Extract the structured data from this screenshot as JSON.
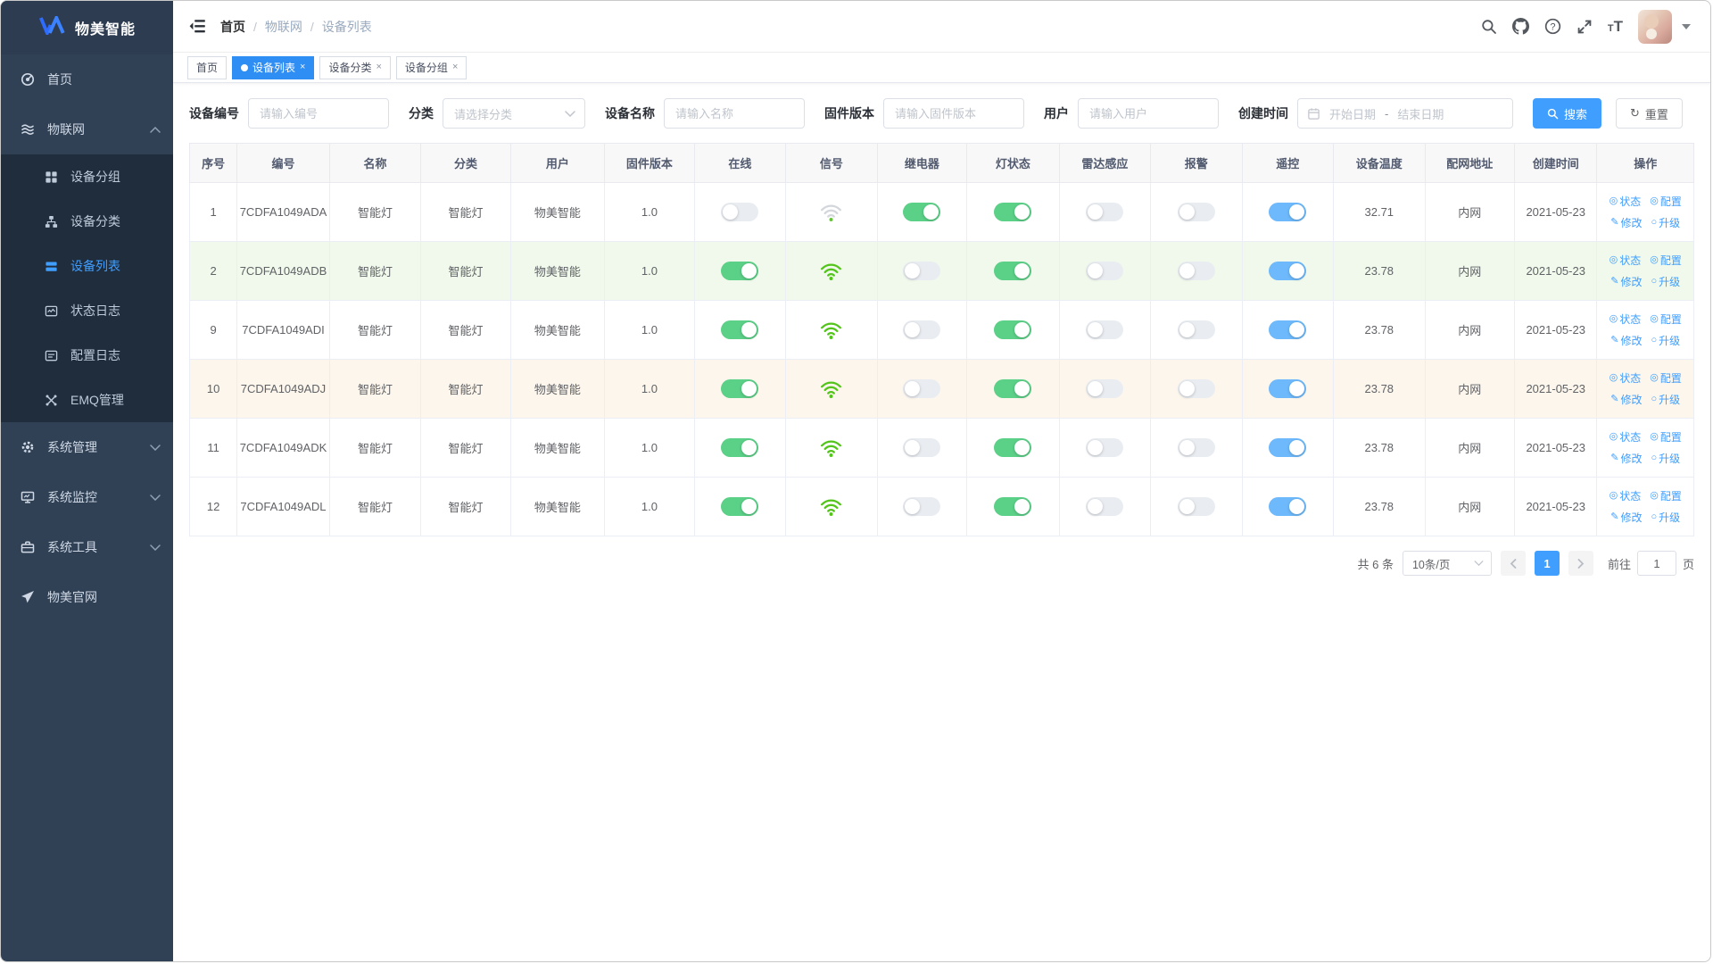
{
  "app": {
    "logo_text": "物美智能"
  },
  "colors": {
    "accent": "#409eff",
    "tab_active": "#2f8ef3",
    "sidebar_bg": "#304156",
    "submenu_bg": "#1f2d3d",
    "toggle_on_green": "#5bd087",
    "toggle_on_blue": "#6db9fb",
    "toggle_off": "#e9edf2",
    "signal_green": "#52c41a",
    "row_highlight_green": "#f0f9eb",
    "row_highlight_orange": "#fdf6ec"
  },
  "sidebar": {
    "items": [
      {
        "id": "home",
        "icon": "dashboard-icon",
        "label": "首页",
        "type": "top"
      },
      {
        "id": "iot",
        "icon": "iot-icon",
        "label": "物联网",
        "type": "top",
        "chevron": "up"
      },
      {
        "id": "device-group",
        "icon": "device-group-icon",
        "label": "设备分组",
        "type": "sub"
      },
      {
        "id": "device-category",
        "icon": "device-category-icon",
        "label": "设备分类",
        "type": "sub"
      },
      {
        "id": "device-list",
        "icon": "device-list-icon",
        "label": "设备列表",
        "type": "sub",
        "active": true
      },
      {
        "id": "status-log",
        "icon": "status-log-icon",
        "label": "状态日志",
        "type": "sub"
      },
      {
        "id": "config-log",
        "icon": "config-log-icon",
        "label": "配置日志",
        "type": "sub"
      },
      {
        "id": "emq",
        "icon": "emq-icon",
        "label": "EMQ管理",
        "type": "sub"
      },
      {
        "id": "system-manage",
        "icon": "gear-icon",
        "label": "系统管理",
        "type": "top",
        "chevron": "down"
      },
      {
        "id": "system-monitor",
        "icon": "monitor-icon",
        "label": "系统监控",
        "type": "top",
        "chevron": "down"
      },
      {
        "id": "system-tools",
        "icon": "toolbox-icon",
        "label": "系统工具",
        "type": "top",
        "chevron": "down"
      },
      {
        "id": "official-site",
        "icon": "paper-plane-icon",
        "label": "物美官网",
        "type": "top"
      }
    ]
  },
  "topbar": {
    "breadcrumb": [
      "首页",
      "物联网",
      "设备列表"
    ],
    "separator": "/"
  },
  "tabs": [
    {
      "id": "home",
      "label": "首页",
      "active": false,
      "closable": false
    },
    {
      "id": "device-list",
      "label": "设备列表",
      "active": true,
      "closable": true
    },
    {
      "id": "device-category",
      "label": "设备分类",
      "active": false,
      "closable": true
    },
    {
      "id": "device-group",
      "label": "设备分组",
      "active": false,
      "closable": true
    }
  ],
  "filters": {
    "device_code": {
      "label": "设备编号",
      "placeholder": "请输入编号"
    },
    "category": {
      "label": "分类",
      "placeholder": "请选择分类"
    },
    "device_name": {
      "label": "设备名称",
      "placeholder": "请输入名称"
    },
    "firmware": {
      "label": "固件版本",
      "placeholder": "请输入固件版本"
    },
    "user": {
      "label": "用户",
      "placeholder": "请输入用户"
    },
    "created": {
      "label": "创建时间",
      "start_placeholder": "开始日期",
      "separator": "-",
      "end_placeholder": "结束日期"
    },
    "search_label": "搜索",
    "reset_label": "重置"
  },
  "table": {
    "headers": [
      "序号",
      "编号",
      "名称",
      "分类",
      "用户",
      "固件版本",
      "在线",
      "信号",
      "继电器",
      "灯状态",
      "雷达感应",
      "报警",
      "遥控",
      "设备温度",
      "配网地址",
      "创建时间",
      "操作"
    ],
    "operations": [
      {
        "id": "status",
        "icon": "status-op-icon",
        "glyph": "◎",
        "label": "状态"
      },
      {
        "id": "config",
        "icon": "config-op-icon",
        "glyph": "◎",
        "label": "配置"
      },
      {
        "id": "edit",
        "icon": "edit-op-icon",
        "glyph": "✎",
        "label": "修改"
      },
      {
        "id": "upgrade",
        "icon": "upgrade-op-icon",
        "glyph": "○",
        "label": "升级"
      }
    ],
    "rows": [
      {
        "no": "1",
        "code": "7CDFA1049ADA",
        "name": "智能灯",
        "category": "智能灯",
        "user": "物美智能",
        "firmware": "1.0",
        "online": false,
        "signal": "weak",
        "relay": true,
        "light": true,
        "radar": false,
        "alarm": false,
        "remote": true,
        "temperature": "32.71",
        "network": "内网",
        "created": "2021-05-23",
        "highlight": "none"
      },
      {
        "no": "2",
        "code": "7CDFA1049ADB",
        "name": "智能灯",
        "category": "智能灯",
        "user": "物美智能",
        "firmware": "1.0",
        "online": true,
        "signal": "strong",
        "relay": false,
        "light": true,
        "radar": false,
        "alarm": false,
        "remote": true,
        "temperature": "23.78",
        "network": "内网",
        "created": "2021-05-23",
        "highlight": "green"
      },
      {
        "no": "9",
        "code": "7CDFA1049ADI",
        "name": "智能灯",
        "category": "智能灯",
        "user": "物美智能",
        "firmware": "1.0",
        "online": true,
        "signal": "strong",
        "relay": false,
        "light": true,
        "radar": false,
        "alarm": false,
        "remote": true,
        "temperature": "23.78",
        "network": "内网",
        "created": "2021-05-23",
        "highlight": "none"
      },
      {
        "no": "10",
        "code": "7CDFA1049ADJ",
        "name": "智能灯",
        "category": "智能灯",
        "user": "物美智能",
        "firmware": "1.0",
        "online": true,
        "signal": "strong",
        "relay": false,
        "light": true,
        "radar": false,
        "alarm": false,
        "remote": true,
        "temperature": "23.78",
        "network": "内网",
        "created": "2021-05-23",
        "highlight": "orange"
      },
      {
        "no": "11",
        "code": "7CDFA1049ADK",
        "name": "智能灯",
        "category": "智能灯",
        "user": "物美智能",
        "firmware": "1.0",
        "online": true,
        "signal": "strong",
        "relay": false,
        "light": true,
        "radar": false,
        "alarm": false,
        "remote": true,
        "temperature": "23.78",
        "network": "内网",
        "created": "2021-05-23",
        "highlight": "none"
      },
      {
        "no": "12",
        "code": "7CDFA1049ADL",
        "name": "智能灯",
        "category": "智能灯",
        "user": "物美智能",
        "firmware": "1.0",
        "online": true,
        "signal": "strong",
        "relay": false,
        "light": true,
        "radar": false,
        "alarm": false,
        "remote": true,
        "temperature": "23.78",
        "network": "内网",
        "created": "2021-05-23",
        "highlight": "none"
      }
    ]
  },
  "pagination": {
    "total": "共 6 条",
    "page_size": "10条/页",
    "current_page": "1",
    "goto_label": "前往",
    "page_unit": "页"
  }
}
